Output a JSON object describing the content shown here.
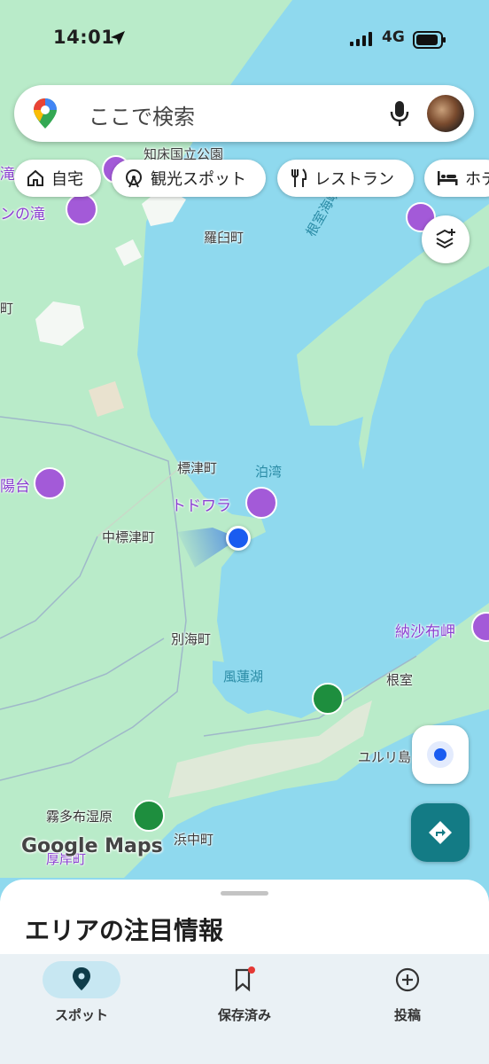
{
  "status_bar": {
    "time": "14:01",
    "network": "4G"
  },
  "search": {
    "placeholder": "ここで検索"
  },
  "chips": [
    {
      "label": "自宅",
      "icon": "home-icon"
    },
    {
      "label": "観光スポット",
      "icon": "ferris-wheel-icon"
    },
    {
      "label": "レストラン",
      "icon": "fork-knife-icon"
    },
    {
      "label": "ホテ",
      "icon": "bed-icon"
    }
  ],
  "map": {
    "labels": {
      "shiretoko_park": "知床国立公園",
      "taki_partial": "滝",
      "n_taki": "ンの滝",
      "rausu": "羅臼町",
      "nemuro_strait": "根室海峡",
      "cho_partial": "町",
      "hi_dai_partial": "陽台",
      "shibetsu_town": "標津町",
      "tomari_bay": "泊湾",
      "todowara": "トドワラ",
      "naka_shibetsu": "中標津町",
      "betsukai": "別海町",
      "notsuke_misaki": "納沙布岬",
      "furen_lake": "風蓮湖",
      "nemuro": "根室",
      "yururi": "ユルリ島",
      "kiritappu": "霧多布湿原",
      "hamanaka": "浜中町",
      "akkeshi_partial": "厚岸町"
    },
    "attribution": "Google Maps"
  },
  "sheet": {
    "title": "エリアの注目情報"
  },
  "bottom_nav": [
    {
      "label": "スポット",
      "icon": "place-icon",
      "selected": true
    },
    {
      "label": "保存済み",
      "icon": "bookmark-icon",
      "selected": false,
      "badge": true
    },
    {
      "label": "投稿",
      "icon": "add-circle-icon",
      "selected": false
    }
  ],
  "colors": {
    "water": "#8fd9ee",
    "land": "#b9ebc9",
    "teal_button": "#137b85",
    "poi_purple": "#a35ad8",
    "location_blue": "#1a5cf0"
  }
}
